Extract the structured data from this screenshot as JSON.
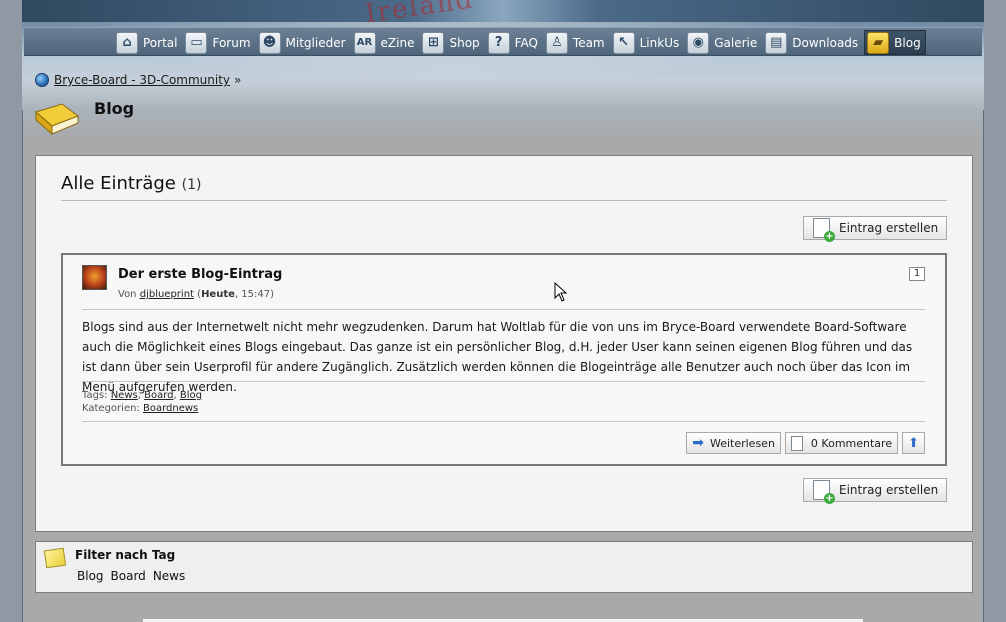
{
  "nav": {
    "items": [
      {
        "label": "Portal",
        "icon": "home-icon",
        "glyph": "⌂"
      },
      {
        "label": "Forum",
        "icon": "monitor-icon",
        "glyph": "▭"
      },
      {
        "label": "Mitglieder",
        "icon": "members-icon",
        "glyph": "☻"
      },
      {
        "label": "eZine",
        "icon": "ezine-icon",
        "glyph": "AR"
      },
      {
        "label": "Shop",
        "icon": "cart-icon",
        "glyph": "⊞"
      },
      {
        "label": "FAQ",
        "icon": "help-icon",
        "glyph": "?"
      },
      {
        "label": "Team",
        "icon": "team-icon",
        "glyph": "♙"
      },
      {
        "label": "LinkUs",
        "icon": "cursor-icon",
        "glyph": "↖"
      },
      {
        "label": "Galerie",
        "icon": "gallery-icon",
        "glyph": "◉"
      },
      {
        "label": "Downloads",
        "icon": "downloads-icon",
        "glyph": "▤"
      },
      {
        "label": "Blog",
        "icon": "blog-icon",
        "glyph": "▰",
        "active": true
      }
    ]
  },
  "breadcrumb": {
    "home": "Bryce-Board - 3D-Community",
    "separator": "»"
  },
  "page": {
    "title": "Blog"
  },
  "main": {
    "heading": "Alle Einträge",
    "count": "(1)",
    "create_label": "Eintrag erstellen"
  },
  "entry": {
    "title": "Der erste Blog-Eintrag",
    "meta_prefix": "Von",
    "author": "djblueprint",
    "date_bold": "Heute",
    "time": ", 15:47)",
    "number": "1",
    "text": "Blogs sind aus der Internetwelt nicht mehr wegzudenken. Darum hat Woltlab für die von uns im Bryce-Board verwendete Board-Software auch die Möglichkeit eines Blogs eingebaut. Das ganze ist ein persönlicher Blog, d.H. jeder User kann seinen eigenen Blog führen und das ist dann über sein Userprofil für andere Zugänglich. Zusätzlich werden können die Blogeinträge alle Benutzer auch noch über das Icon im Menü aufgerufen werden.",
    "tags_label": "Tags:",
    "tags": [
      "News",
      "Board",
      "Blog"
    ],
    "categories_label": "Kategorien:",
    "category": "Boardnews",
    "read_more": "Weiterlesen",
    "comments": "0 Kommentare"
  },
  "filter": {
    "title": "Filter nach Tag",
    "tags": [
      "Blog",
      "Board",
      "News"
    ]
  }
}
